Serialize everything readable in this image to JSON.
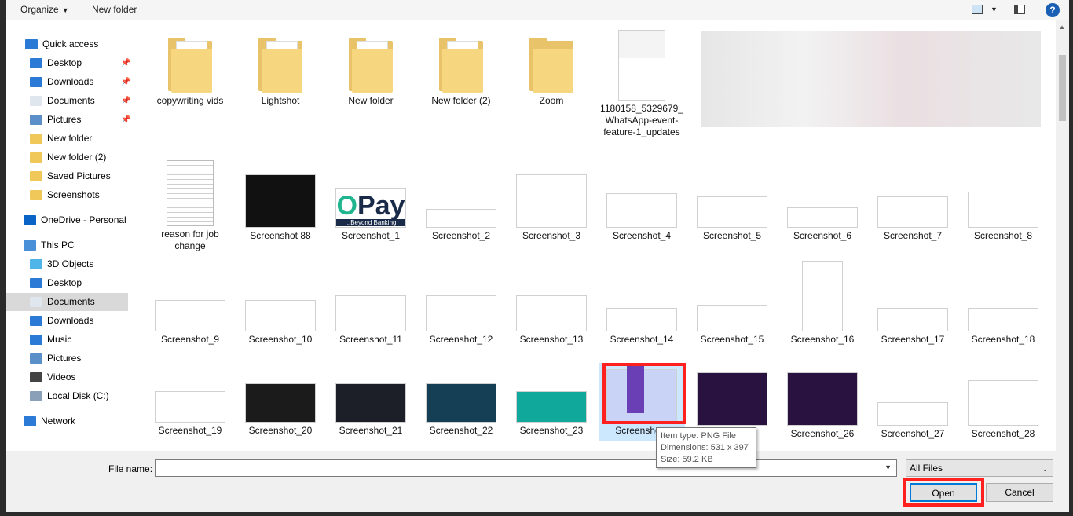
{
  "toolbar": {
    "organize": "Organize",
    "new_folder": "New folder",
    "help": "?"
  },
  "nav": {
    "items": [
      {
        "label": "Quick access",
        "icon": "star-icon",
        "pinned": false
      },
      {
        "label": "Desktop",
        "icon": "desktop-icon",
        "pinned": true
      },
      {
        "label": "Downloads",
        "icon": "download-icon",
        "pinned": true
      },
      {
        "label": "Documents",
        "icon": "documents-icon",
        "pinned": true
      },
      {
        "label": "Pictures",
        "icon": "pictures-icon",
        "pinned": true
      },
      {
        "label": "New folder",
        "icon": "folder-icon",
        "pinned": false
      },
      {
        "label": "New folder (2)",
        "icon": "folder-icon",
        "pinned": false
      },
      {
        "label": "Saved Pictures",
        "icon": "folder-icon",
        "pinned": false
      },
      {
        "label": "Screenshots",
        "icon": "folder-icon",
        "pinned": false
      },
      {
        "label": "OneDrive - Personal",
        "icon": "cloud-icon",
        "pinned": false
      },
      {
        "label": "This PC",
        "icon": "computer-icon",
        "pinned": false
      },
      {
        "label": "3D Objects",
        "icon": "cube-icon",
        "pinned": false
      },
      {
        "label": "Desktop",
        "icon": "desktop-icon",
        "pinned": false
      },
      {
        "label": "Documents",
        "icon": "documents-icon",
        "pinned": false,
        "selected": true
      },
      {
        "label": "Downloads",
        "icon": "download-icon",
        "pinned": false
      },
      {
        "label": "Music",
        "icon": "music-icon",
        "pinned": false
      },
      {
        "label": "Pictures",
        "icon": "pictures-icon",
        "pinned": false
      },
      {
        "label": "Videos",
        "icon": "video-icon",
        "pinned": false
      },
      {
        "label": "Local Disk (C:)",
        "icon": "disk-icon",
        "pinned": false
      },
      {
        "label": "Network",
        "icon": "network-icon",
        "pinned": false
      }
    ]
  },
  "files": {
    "row1": [
      "copywriting vids",
      "Lightshot",
      "New folder",
      "New folder (2)",
      "Zoom",
      "1180158_5329679_WhatsApp-event-feature-1_updates"
    ],
    "row2": [
      "reason for job change",
      "Screenshot 88",
      "Screenshot_1",
      "Screenshot_2",
      "Screenshot_3",
      "Screenshot_4",
      "Screenshot_5",
      "Screenshot_6",
      "Screenshot_7",
      "Screenshot_8"
    ],
    "row3": [
      "Screenshot_9",
      "Screenshot_10",
      "Screenshot_11",
      "Screenshot_12",
      "Screenshot_13",
      "Screenshot_14",
      "Screenshot_15",
      "Screenshot_16",
      "Screenshot_17",
      "Screenshot_18"
    ],
    "row4": [
      "Screenshot_19",
      "Screenshot_20",
      "Screenshot_21",
      "Screenshot_22",
      "Screenshot_23",
      "Screenshot_",
      "",
      "Screenshot_26",
      "Screenshot_27",
      "Screenshot_28"
    ]
  },
  "thumb_text": {
    "opay": "Pay",
    "opay_sub": "...Beyond Banking"
  },
  "tooltip": {
    "type": "Item type: PNG File",
    "dimensions": "Dimensions: 531 x 397",
    "size": "Size: 59.2 KB"
  },
  "footer": {
    "file_name_label": "File name:",
    "file_name_value": "",
    "filter": "All Files",
    "open": "Open",
    "cancel": "Cancel"
  },
  "colors": {
    "highlight": "#ff2020",
    "accent": "#0078d7",
    "selected_bg": "#cce8ff"
  }
}
